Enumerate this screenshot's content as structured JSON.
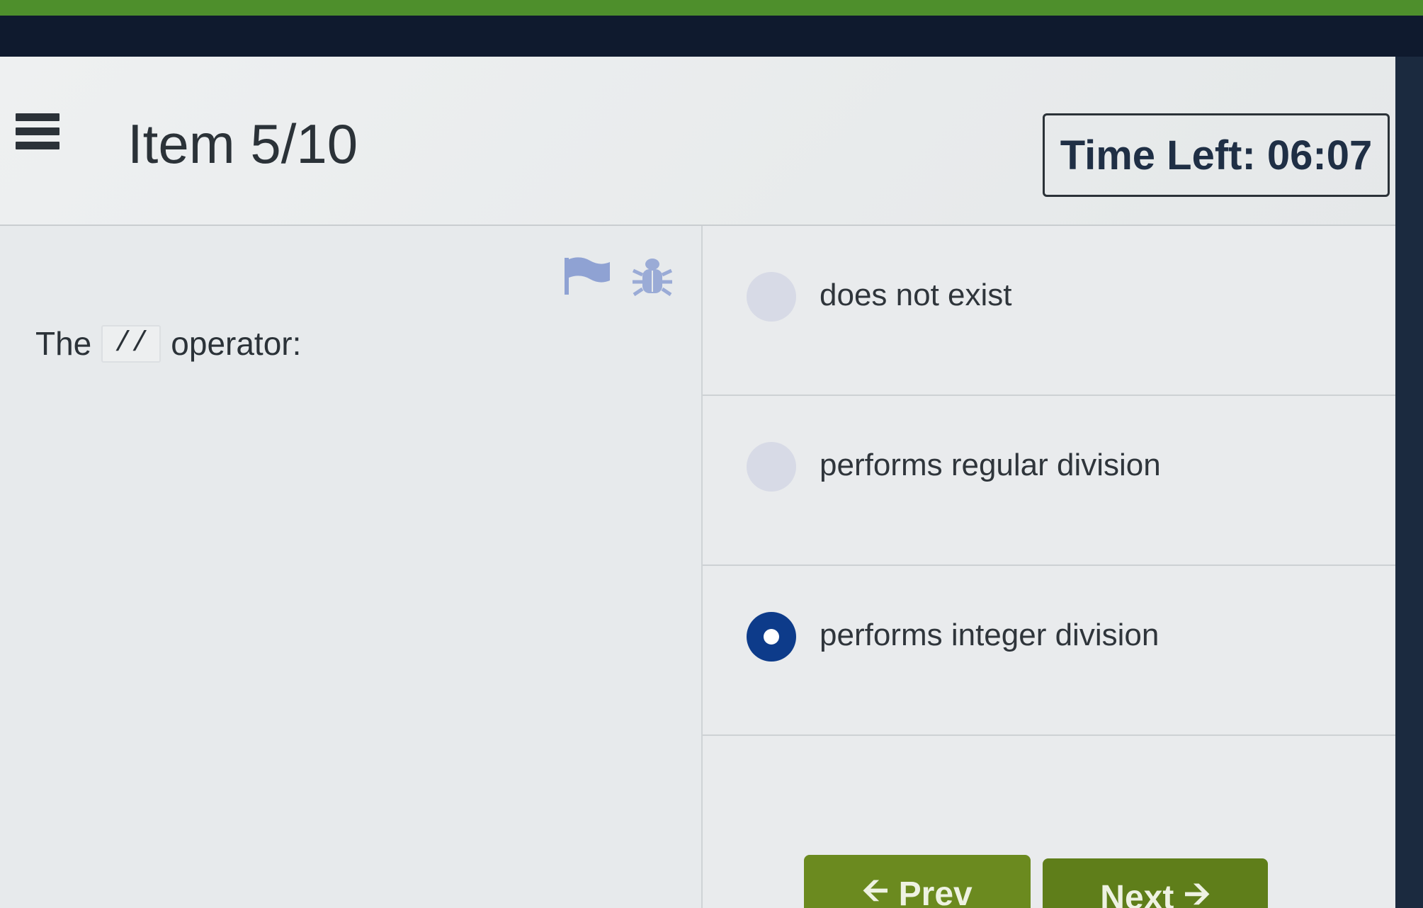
{
  "header": {
    "item_counter": "Item 5/10",
    "timer": "Time Left: 06:07"
  },
  "icons": {
    "menu": "hamburger-menu-icon",
    "flag": "flag-icon",
    "bug": "bug-icon",
    "prev_arrow": "arrow-left-icon",
    "next_arrow": "arrow-right-icon"
  },
  "question": {
    "prefix": "The",
    "code": "//",
    "suffix": "operator:"
  },
  "answers": [
    {
      "label": "does not exist",
      "selected": false
    },
    {
      "label": "performs regular division",
      "selected": false
    },
    {
      "label": "performs integer division",
      "selected": true
    }
  ],
  "buttons": {
    "prev_label": "Prev",
    "next_label": "Next"
  },
  "colors": {
    "accent_green": "#6b8a1f",
    "selected_radio": "#0d3b8a",
    "text": "#2b3238"
  }
}
